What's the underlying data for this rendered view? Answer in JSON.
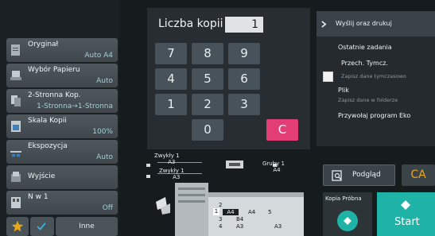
{
  "settings": [
    {
      "label": "Oryginał",
      "value": "Auto A4"
    },
    {
      "label": "Wybór Papieru",
      "value": "Auto"
    },
    {
      "label": "2-Stronna Kop.",
      "value": "1-Stronna→1-Stronna"
    },
    {
      "label": "Skala Kopii",
      "value": "100%"
    },
    {
      "label": "Ekspozycja",
      "value": "Auto"
    },
    {
      "label": "Wyjście",
      "value": ""
    },
    {
      "label": "N w 1",
      "value": "Off"
    }
  ],
  "bottom": {
    "others_label": "Inne"
  },
  "keypad": {
    "copies_label": "Liczba kopii",
    "copies_value": "1",
    "keys": [
      "7",
      "8",
      "9",
      "4",
      "5",
      "6",
      "1",
      "2",
      "3",
      "0"
    ],
    "clear": "C"
  },
  "machine": {
    "tray1": {
      "name": "Zwykły 1",
      "size": "A3"
    },
    "tray2": {
      "name": "Zwykły 1",
      "size": "A3"
    },
    "tray3": {
      "name": "Gruby 1",
      "size": "A4"
    },
    "cassettes": [
      {
        "num": "2",
        "size": "A4"
      },
      {
        "num": "3",
        "size": "B4"
      },
      {
        "num": "4",
        "size": "A3"
      },
      {
        "num": "5",
        "size": ""
      }
    ],
    "cassette1": "1",
    "sizeA4": "A4",
    "sizeA3": "A3"
  },
  "right": {
    "send_print": "Wyślij oraz drukuj",
    "recent_jobs": "Ostatnie zadania",
    "temp_save": "Przech. Tymcz.",
    "temp_save_sub": "Zapisz dane tymczasowo",
    "file": "Plik",
    "file_sub": "Zapisz dane w folderze",
    "eco": "Przywołaj program Eko",
    "preview": "Podgląd",
    "ca": "CA",
    "proof": "Kopia Próbna",
    "start": "Start"
  },
  "colors": {
    "accent": "#1fb3a7",
    "clear": "#e23d74",
    "favorite": "#e9a71b",
    "check": "#36b6e8",
    "value_text": "#9fd0d8"
  },
  "icons": [
    "star-icon",
    "check-icon",
    "chevron-right-icon",
    "preview-icon",
    "diamond-icon"
  ]
}
